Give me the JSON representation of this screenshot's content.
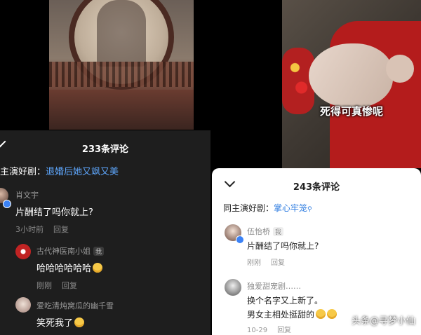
{
  "left_video": {
    "subtitle": ""
  },
  "right_video": {
    "subtitle": "死得可真惨呢"
  },
  "dark_panel": {
    "title": "233条评论",
    "same_cast_label": "主演好剧：",
    "same_cast_link": "退婚后她又飒又美",
    "comments": [
      {
        "user": "肖文宇",
        "text": "片酬结了吗你就上?",
        "time": "3小时前",
        "reply": "回复"
      },
      {
        "user": "古代神医南小姐",
        "badge": "我",
        "text": "哈哈哈哈哈哈",
        "time": "刚刚",
        "reply": "回复"
      },
      {
        "user": "爱吃清炖窝瓜的幽千雪",
        "text": "笑死我了",
        "time": "",
        "reply": ""
      }
    ]
  },
  "light_panel": {
    "title": "243条评论",
    "same_cast_label": "同主演好剧：",
    "same_cast_link": "掌心牢笼",
    "comments": [
      {
        "user": "伍怡桥",
        "badge": "我",
        "text": "片酬结了吗你就上?",
        "time": "刚刚",
        "reply": "回复"
      },
      {
        "user": "独爱甜宠剧……",
        "text": "换个名字又上新了。",
        "text2": "男女主相处挺甜的",
        "time": "10-29",
        "reply": "回复"
      }
    ]
  },
  "watermark": "头条@寻梦小仙",
  "colors": {
    "link_dark": "#5fa8ff",
    "link_light": "#2f7de1",
    "dark_bg": "#1e1e1e"
  }
}
